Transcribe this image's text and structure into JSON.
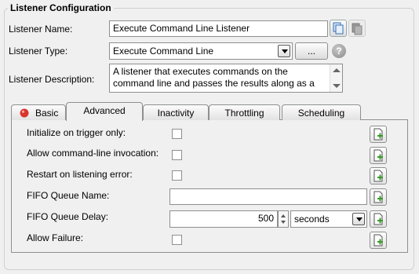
{
  "section": {
    "title": "Listener Configuration"
  },
  "fields": {
    "name_label": "Listener Name:",
    "name_value": "Execute Command Line Listener",
    "type_label": "Listener Type:",
    "type_value": "Execute Command Line",
    "browse_label": "...",
    "help_label": "?",
    "description_label": "Listener Description:",
    "description_line1": "A listener that executes commands on the",
    "description_line2": "command line and passes the results along as a"
  },
  "tabs": [
    {
      "label": "Basic"
    },
    {
      "label": "Advanced"
    },
    {
      "label": "Inactivity"
    },
    {
      "label": "Throttling"
    },
    {
      "label": "Scheduling"
    }
  ],
  "advanced": {
    "init_trigger_label": "Initialize on trigger only:",
    "allow_cmdline_label": "Allow command-line invocation:",
    "restart_label": "Restart on listening error:",
    "fifo_name_label": "FIFO Queue Name:",
    "fifo_name_value": "",
    "fifo_delay_label": "FIFO Queue Delay:",
    "fifo_delay_value": "500",
    "fifo_delay_unit": "seconds",
    "allow_failure_label": "Allow Failure:"
  },
  "colors": {
    "error_dot": "#d9342b",
    "add_plus": "#3a9a2a"
  }
}
